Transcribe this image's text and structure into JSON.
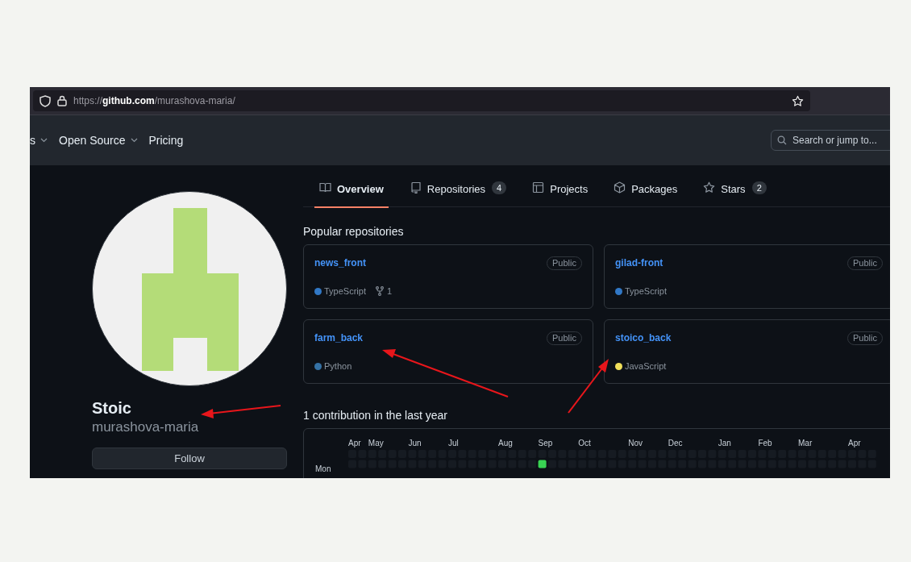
{
  "browser": {
    "url_scheme": "https://",
    "url_host": "github.com",
    "url_path": "/murashova-maria/"
  },
  "nav": {
    "items": [
      {
        "label": "s",
        "dropdown": true
      },
      {
        "label": "Open Source",
        "dropdown": true
      },
      {
        "label": "Pricing",
        "dropdown": false
      }
    ],
    "search": {
      "placeholder": "Search or jump to..."
    }
  },
  "tabs": [
    {
      "label": "Overview",
      "selected": true
    },
    {
      "label": "Repositories",
      "count": "4",
      "selected": false
    },
    {
      "label": "Projects",
      "selected": false
    },
    {
      "label": "Packages",
      "selected": false
    },
    {
      "label": "Stars",
      "count": "2",
      "selected": false
    }
  ],
  "profile": {
    "name": "Stoic",
    "username": "murashova-maria",
    "follow_button": "Follow"
  },
  "popular_repositories": {
    "title": "Popular repositories",
    "repos": [
      {
        "name": "news_front",
        "visibility": "Public",
        "language": "TypeScript",
        "color": "#3178c6",
        "forks": "1"
      },
      {
        "name": "gilad-front",
        "visibility": "Public",
        "language": "TypeScript",
        "color": "#3178c6"
      },
      {
        "name": "farm_back",
        "visibility": "Public",
        "language": "Python",
        "color": "#3572a5"
      },
      {
        "name": "stoico_back",
        "visibility": "Public",
        "language": "JavaScript",
        "color": "#f1e05a"
      }
    ]
  },
  "contributions": {
    "title": "1 contribution in the last year",
    "months": [
      "Apr",
      "May",
      "Jun",
      "Jul",
      "Aug",
      "Sep",
      "Oct",
      "Nov",
      "Dec",
      "Jan",
      "Feb",
      "Mar",
      "Apr"
    ],
    "day_labels": [
      "Mon"
    ]
  }
}
